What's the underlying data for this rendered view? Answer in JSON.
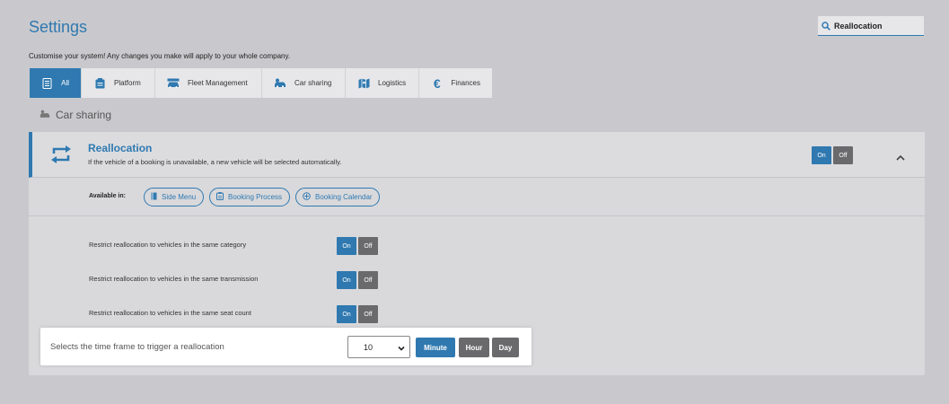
{
  "header": {
    "title": "Settings",
    "subtitle": "Customise your system! Any changes you make will apply to your whole company."
  },
  "search": {
    "value": "Reallocation",
    "icon": "search-icon"
  },
  "tabs": [
    {
      "label": "All",
      "icon": "list-icon",
      "active": true
    },
    {
      "label": "Platform",
      "icon": "clipboard-icon",
      "active": false
    },
    {
      "label": "Fleet Management",
      "icon": "car-icon",
      "active": false
    },
    {
      "label": "Car sharing",
      "icon": "car-sharing-icon",
      "active": false
    },
    {
      "label": "Logistics",
      "icon": "map-icon",
      "active": false
    },
    {
      "label": "Finances",
      "icon": "euro-icon",
      "active": false
    }
  ],
  "section": {
    "label": "Car sharing",
    "icon": "car-sharing-icon"
  },
  "feature": {
    "title": "Reallocation",
    "description": "If the vehicle of a booking is unavailable, a new vehicle will be selected automatically.",
    "icon": "reallocation-icon",
    "toggle": {
      "on": "On",
      "off": "Off",
      "state": "on"
    },
    "collapse_icon": "chevron-up-icon",
    "available_label": "Available in:",
    "available_in": [
      {
        "label": "Side Menu",
        "icon": "book-icon"
      },
      {
        "label": "Booking Process",
        "icon": "clipboard-icon"
      },
      {
        "label": "Booking Calendar",
        "icon": "plus-circle-icon"
      }
    ],
    "sub_settings": [
      {
        "label": "Restrict reallocation to vehicles in the same category",
        "on": "On",
        "off": "Off"
      },
      {
        "label": "Restrict reallocation to vehicles in the same transmission",
        "on": "On",
        "off": "Off"
      },
      {
        "label": "Restrict reallocation to vehicles in the same seat count",
        "on": "On",
        "off": "Off"
      }
    ],
    "time_frame": {
      "label": "Selects the time frame to trigger a reallocation",
      "value": "10",
      "units": [
        "Minute",
        "Hour",
        "Day"
      ],
      "selected_unit": "Minute"
    }
  },
  "colors": {
    "accent": "#2f79b0",
    "inactive": "#6a6a6c",
    "background": "#c9c9cd"
  }
}
